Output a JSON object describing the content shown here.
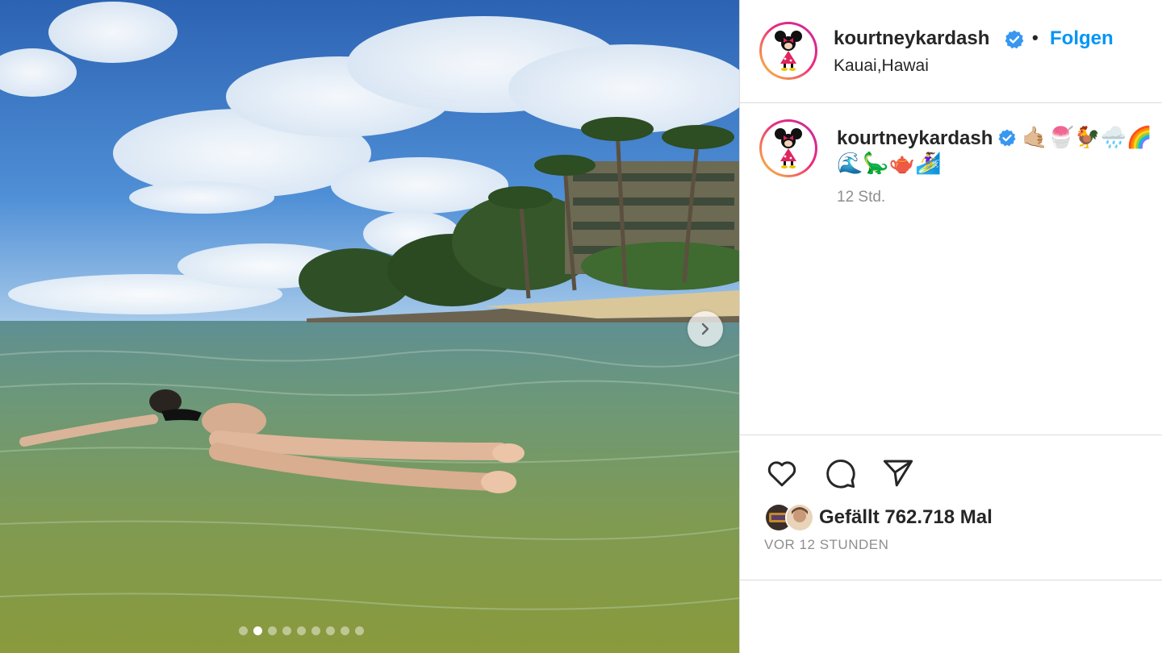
{
  "post": {
    "username": "kourtneykardash",
    "location": "Kauai,Hawai",
    "follow_label": "Folgen",
    "separator": "•",
    "caption_emojis_line1": "🤙🏼🍧🐓🌧️🌈",
    "caption_emojis_line2": "🌊🦕🫖🏄‍♀️",
    "caption_time": "12 Std.",
    "likes_text": "Gefällt 762.718 Mal",
    "time_ago": "VOR 12 STUNDEN",
    "carousel": {
      "total": 9,
      "active": 1
    }
  },
  "colors": {
    "accent": "#0095f6",
    "verified": "#3897f0",
    "muted": "#8e8e8e",
    "border": "#dbdbdb"
  },
  "icons": {
    "next": "chevron-right-icon",
    "verified": "verified-badge-icon",
    "like": "heart-icon",
    "comment": "comment-icon",
    "share": "paper-plane-icon"
  }
}
